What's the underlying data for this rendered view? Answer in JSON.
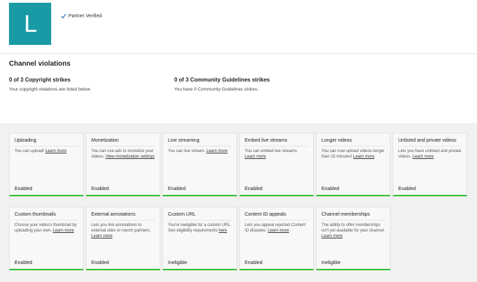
{
  "header": {
    "avatar_letter": "L",
    "avatar_color": "#1a9aa5",
    "verified_label": "Partner Verified",
    "verified_icon": "checkmark-icon"
  },
  "violations": {
    "title": "Channel violations",
    "copyright": {
      "title": "0 of 3 Copyright strikes",
      "subtitle": "Your copyright violations are listed below."
    },
    "guidelines": {
      "title": "0 of 3 Community Guidelines strikes",
      "subtitle": "You have 0 Community Guidelines strikes."
    }
  },
  "status_color": "#2fbd2f",
  "features": [
    {
      "title": "Uploading",
      "desc": "You can upload!",
      "link": "Learn more",
      "status": "Enabled"
    },
    {
      "title": "Monetization",
      "desc": "You can use ads to monetize your videos.",
      "link": "View monetization settings",
      "status": "Enabled"
    },
    {
      "title": "Live streaming",
      "desc": "You can live stream.",
      "link": "Learn more",
      "status": "Enabled"
    },
    {
      "title": "Embed live streams",
      "desc": "You can embed live streams.",
      "link": "Learn more",
      "status": "Enabled"
    },
    {
      "title": "Longer videos",
      "desc": "You can now upload videos longer than 15 minutes!",
      "link": "Learn more",
      "status": "Enabled"
    },
    {
      "title": "Unlisted and private videos",
      "desc": "Lets you have unlisted and private videos.",
      "link": "Learn more",
      "status": "Enabled"
    },
    {
      "title": "Custom thumbnails",
      "desc": "Choose your video's thumbnail by uploading your own.",
      "link": "Learn more",
      "status": "Enabled"
    },
    {
      "title": "External annotations",
      "desc": "Lets you link annotations to external sites or merch partners.",
      "link": "Learn more",
      "status": "Enabled"
    },
    {
      "title": "Custom URL",
      "desc": "You're ineligible for a custom URL. See eligibility requirements",
      "link": "here",
      "status": "Ineligible"
    },
    {
      "title": "Content ID appeals",
      "desc": "Lets you appeal rejected Content ID disputes.",
      "link": "Learn more",
      "status": "Enabled"
    },
    {
      "title": "Channel memberships",
      "desc": "The ability to offer memberships isn't yet available for your channel.",
      "link": "Learn more",
      "status": "Ineligible"
    }
  ]
}
